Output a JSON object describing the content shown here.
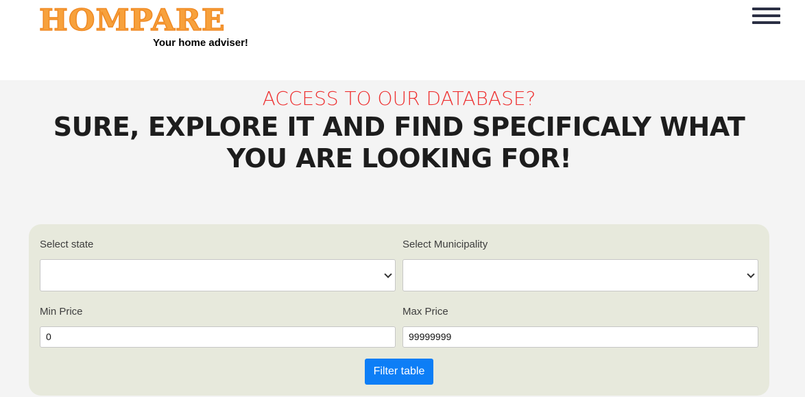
{
  "header": {
    "logo_text": "HOMPARE",
    "tagline": "Your home adviser!",
    "menu_icon": "hamburger-menu-icon"
  },
  "hero": {
    "kicker": "ACCESS TO OUR DATABASE?",
    "headline": "SURE, EXPLORE IT AND FIND SPECIFICALY WHAT YOU ARE LOOKING FOR!"
  },
  "filters": {
    "state_label": "Select state",
    "state_value": "",
    "municipality_label": "Select Municipality",
    "municipality_value": "",
    "min_price_label": "Min Price",
    "min_price_value": "0",
    "max_price_label": "Max Price",
    "max_price_value": "99999999",
    "submit_label": "Filter table"
  },
  "colors": {
    "logo": "#f7a13c",
    "kicker": "#ee3131",
    "button": "#0d7ef6",
    "panel": "#e7e9dc"
  }
}
